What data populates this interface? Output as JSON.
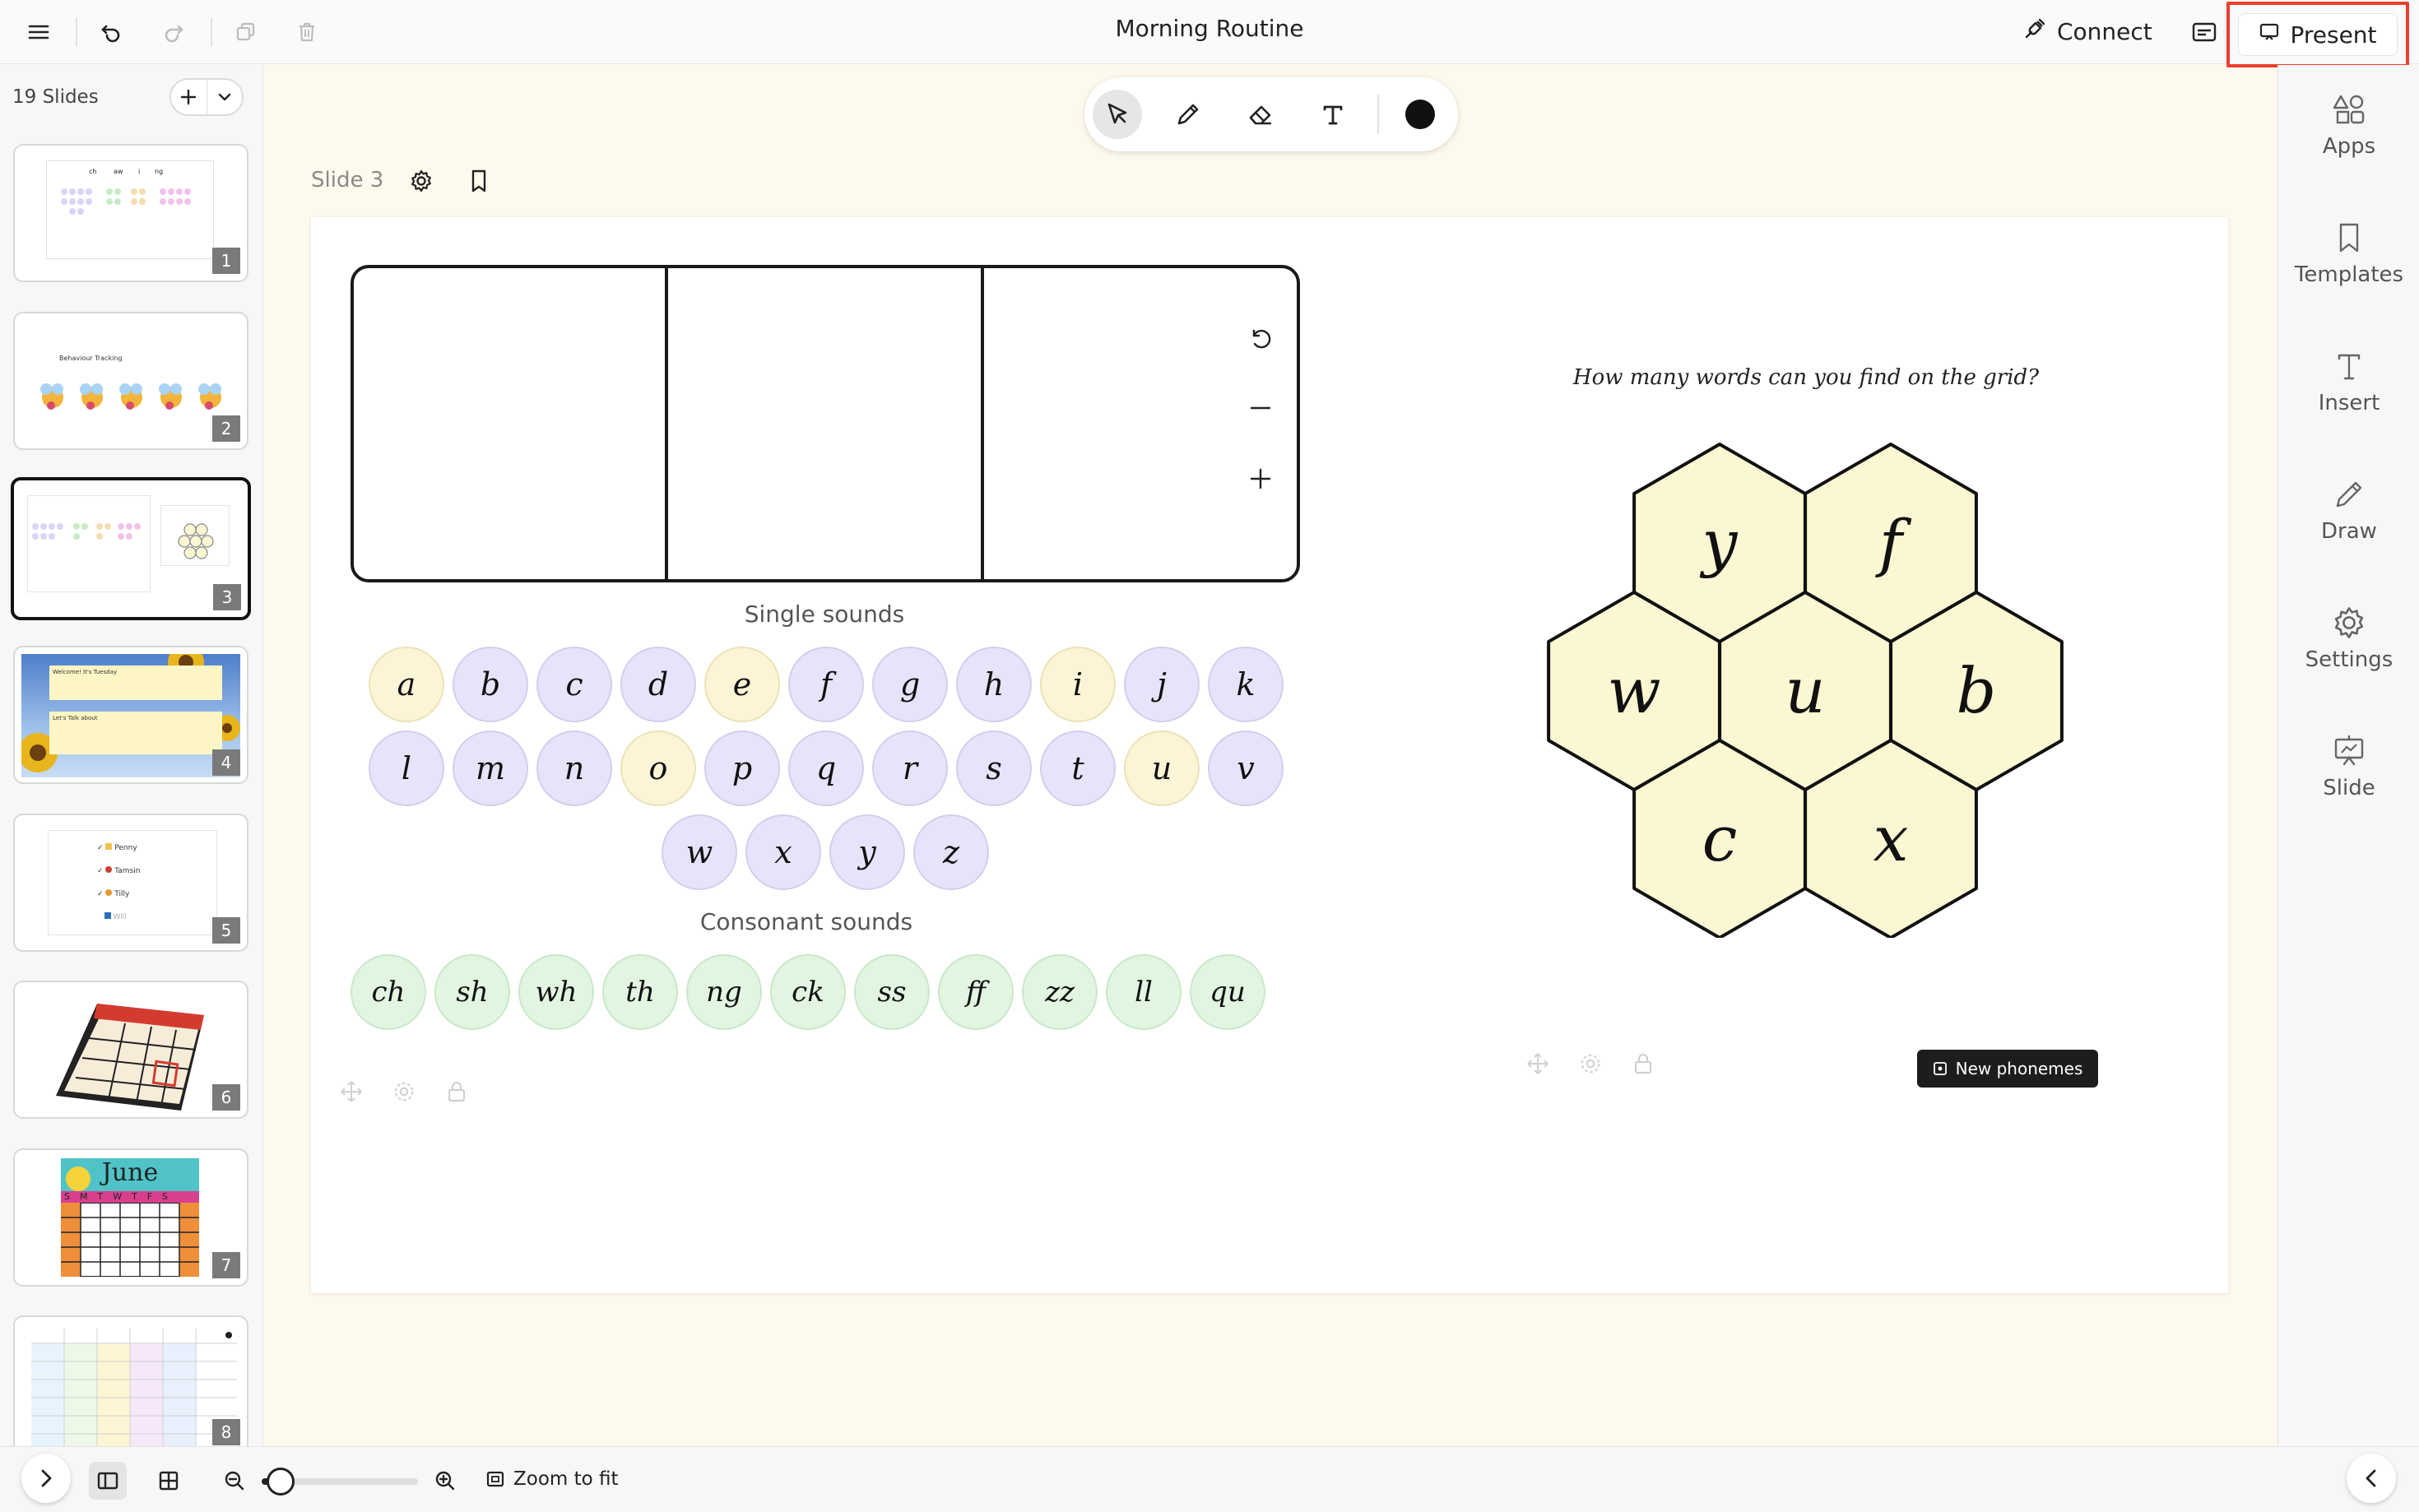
{
  "app": {
    "title": "Morning Routine",
    "connect_label": "Connect",
    "present_label": "Present"
  },
  "left_panel": {
    "slides_count": "19 Slides",
    "thumbnails": [
      {
        "number": "1"
      },
      {
        "number": "2"
      },
      {
        "number": "3",
        "active": true
      },
      {
        "number": "4"
      },
      {
        "number": "5"
      },
      {
        "number": "6"
      },
      {
        "number": "7"
      },
      {
        "number": "8"
      }
    ],
    "thumb_texts": {
      "t1_headers": [
        "ch",
        "aw",
        "i",
        "ng"
      ],
      "t2_title": "Behaviour Tracking",
      "t4_line1": "Welcome! It's Tuesday",
      "t4_line2": "Let's Talk about",
      "t5_names": [
        "Penny",
        "Tamsin",
        "Tilly",
        "Will"
      ],
      "t7_month": "June",
      "t7_days": "SMTWTFS"
    }
  },
  "canvas": {
    "slide_label": "Slide 3",
    "single_sounds_label": "Single sounds",
    "consonant_sounds_label": "Consonant sounds",
    "single_rows": [
      [
        {
          "l": "a",
          "k": "v"
        },
        {
          "l": "b",
          "k": "c"
        },
        {
          "l": "c",
          "k": "c"
        },
        {
          "l": "d",
          "k": "c"
        },
        {
          "l": "e",
          "k": "v"
        },
        {
          "l": "f",
          "k": "c"
        },
        {
          "l": "g",
          "k": "c"
        },
        {
          "l": "h",
          "k": "c"
        },
        {
          "l": "i",
          "k": "v"
        },
        {
          "l": "j",
          "k": "c"
        },
        {
          "l": "k",
          "k": "c"
        }
      ],
      [
        {
          "l": "l",
          "k": "c"
        },
        {
          "l": "m",
          "k": "c"
        },
        {
          "l": "n",
          "k": "c"
        },
        {
          "l": "o",
          "k": "v"
        },
        {
          "l": "p",
          "k": "c"
        },
        {
          "l": "q",
          "k": "c"
        },
        {
          "l": "r",
          "k": "c"
        },
        {
          "l": "s",
          "k": "c"
        },
        {
          "l": "t",
          "k": "c"
        },
        {
          "l": "u",
          "k": "v"
        },
        {
          "l": "v",
          "k": "c"
        }
      ],
      [
        {
          "l": "w",
          "k": "c"
        },
        {
          "l": "x",
          "k": "c"
        },
        {
          "l": "y",
          "k": "c"
        },
        {
          "l": "z",
          "k": "c"
        }
      ]
    ],
    "consonant_sounds": [
      "ch",
      "sh",
      "wh",
      "th",
      "ng",
      "ck",
      "ss",
      "ff",
      "zz",
      "ll",
      "qu"
    ],
    "grid_prompt": "How many words can you find on the grid?",
    "hex_letters": [
      "y",
      "f",
      "w",
      "u",
      "b",
      "c",
      "x"
    ],
    "new_phonemes_label": "New phonemes"
  },
  "right_rail": {
    "items": [
      {
        "label": "Apps",
        "icon": "shapes-icon"
      },
      {
        "label": "Templates",
        "icon": "bookmark-icon"
      },
      {
        "label": "Insert",
        "icon": "text-icon"
      },
      {
        "label": "Draw",
        "icon": "pencil-icon"
      },
      {
        "label": "Settings",
        "icon": "gear-icon"
      },
      {
        "label": "Slide",
        "icon": "presentation-icon"
      }
    ]
  },
  "bottom_bar": {
    "zoom_to_fit_label": "Zoom to fit",
    "zoom_level": 0.12
  },
  "colors": {
    "accent_highlight": "#e8402e",
    "consonant_tile": "#e6e4fa",
    "vowel_tile": "#fbf4d6",
    "digraph_tile": "#e1f5e1",
    "hex_fill": "#fbf7d3",
    "canvas_bg": "#fdf9ec"
  }
}
